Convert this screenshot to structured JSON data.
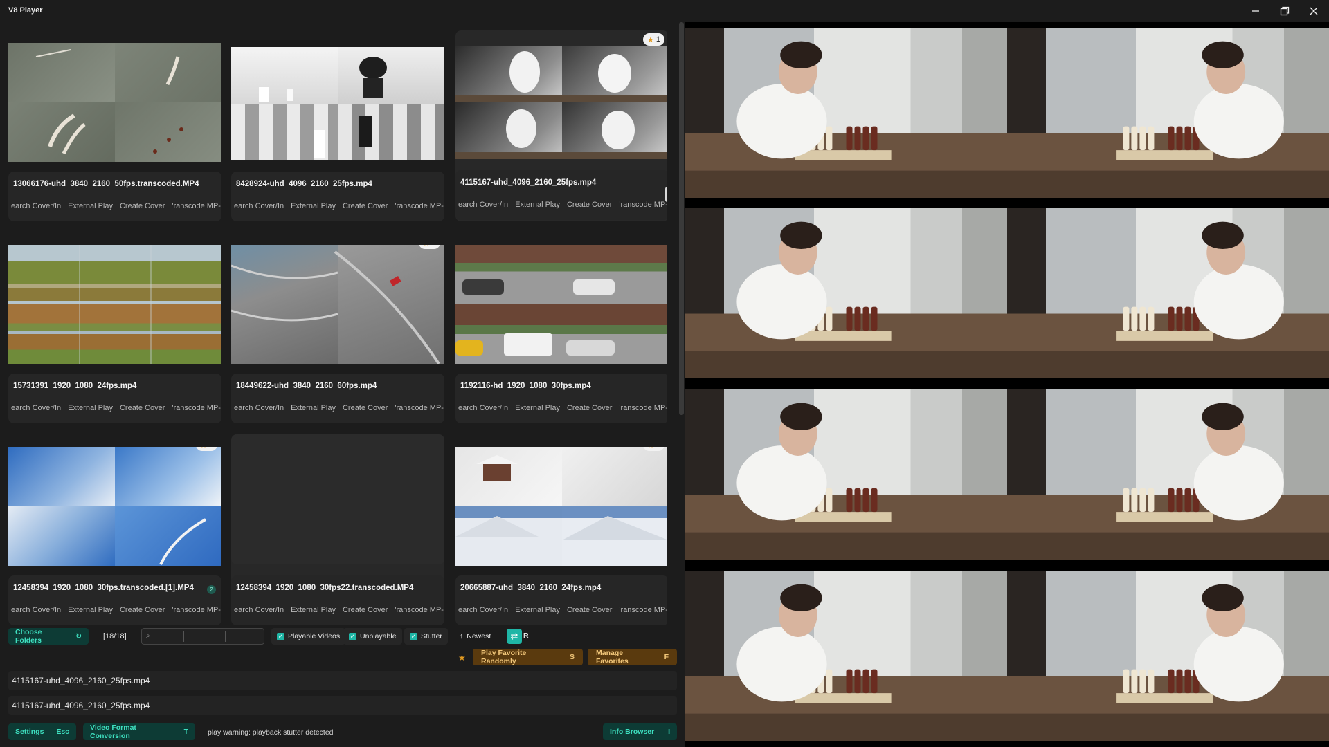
{
  "app": {
    "title": "V8 Player"
  },
  "window_controls": {
    "minimize": "minimize-icon",
    "maximize": "maximize-icon",
    "close": "close-icon"
  },
  "videos": [
    {
      "filename": "13066176-uhd_3840_2160_50fps.transcoded.MP4",
      "rating": null
    },
    {
      "filename": "8428924-uhd_4096_2160_25fps.mp4",
      "rating": null
    },
    {
      "filename": "4115167-uhd_4096_2160_25fps.mp4",
      "rating": "1"
    },
    {
      "filename": "15731391_1920_1080_24fps.mp4",
      "rating": null
    },
    {
      "filename": "18449622-uhd_3840_2160_60fps.mp4",
      "rating": "2"
    },
    {
      "filename": "1192116-hd_1920_1080_30fps.mp4",
      "rating": null
    },
    {
      "filename": "12458394_1920_1080_30fps.transcoded.[1].MP4",
      "rating": "1",
      "count_badge": "2"
    },
    {
      "filename": "12458394_1920_1080_30fps22.transcoded.MP4",
      "rating": null
    },
    {
      "filename": "20665887-uhd_3840_2160_24fps.mp4",
      "rating": "1"
    }
  ],
  "card_actions": {
    "search_cover": "earch Cover/In",
    "external_play": "External Play",
    "create_cover": "Create Cover",
    "transcode": "'ranscode MP-"
  },
  "toolbar": {
    "choose_folders": "Choose Folders",
    "count": "[18/18]",
    "search_placeholder": "",
    "playable": "Playable Videos",
    "unplayable": "Unplayable",
    "stutter": "Stutter",
    "sort": "Newest",
    "random_key": "R",
    "play_favorite": "Play Favorite Randomly",
    "play_favorite_key": "S",
    "manage_favorites": "Manage Favorites",
    "manage_favorites_key": "F"
  },
  "paths": [
    "4115167-uhd_4096_2160_25fps.mp4",
    "4115167-uhd_4096_2160_25fps.mp4"
  ],
  "bottom": {
    "settings": "Settings",
    "settings_key": "Esc",
    "format_conversion": "Video Format Conversion",
    "format_key": "T",
    "status": "play warning: playback stutter detected",
    "info_browser": "Info Browser",
    "info_key": "I"
  },
  "colors": {
    "teal": "#3ee0c0",
    "teal_bg": "#0d3b35",
    "gold": "#f2c77a",
    "gold_bg": "#5a3a0e",
    "star": "#e39b21"
  }
}
